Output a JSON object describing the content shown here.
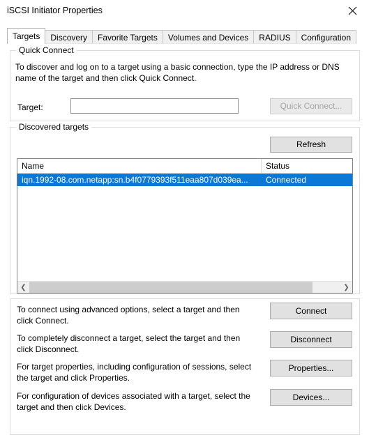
{
  "window": {
    "title": "iSCSI Initiator Properties",
    "close_icon": "close-icon"
  },
  "tabs": [
    {
      "label": "Targets",
      "selected": true
    },
    {
      "label": "Discovery",
      "selected": false
    },
    {
      "label": "Favorite Targets",
      "selected": false
    },
    {
      "label": "Volumes and Devices",
      "selected": false
    },
    {
      "label": "RADIUS",
      "selected": false
    },
    {
      "label": "Configuration",
      "selected": false
    }
  ],
  "quick_connect": {
    "group_title": "Quick Connect",
    "description": "To discover and log on to a target using a basic connection, type the IP address or DNS name of the target and then click Quick Connect.",
    "target_label": "Target:",
    "target_value": "",
    "target_placeholder": "",
    "button_label": "Quick Connect...",
    "button_disabled": true
  },
  "discovered_targets": {
    "group_title": "Discovered targets",
    "refresh_label": "Refresh",
    "columns": [
      "Name",
      "Status"
    ],
    "rows": [
      {
        "name": "iqn.1992-08.com.netapp:sn.b4f0779393f511eaa807d039ea...",
        "status": "Connected",
        "selected": true
      }
    ],
    "scrollbar": {
      "left_arrow": "chevron-left-icon",
      "right_arrow": "chevron-right-icon",
      "thumb_percent": 91
    }
  },
  "actions": [
    {
      "text": "To connect using advanced options, select a target and then click Connect.",
      "button": "Connect"
    },
    {
      "text": "To completely disconnect a target, select the target and then click Disconnect.",
      "button": "Disconnect"
    },
    {
      "text": "For target properties, including configuration of sessions, select the target and click Properties.",
      "button": "Properties..."
    },
    {
      "text": "For configuration of devices associated with a target, select the target and then click Devices.",
      "button": "Devices..."
    }
  ],
  "colors": {
    "selection_blue": "#0a78d7",
    "button_face": "#e1e1e1",
    "window_bg": "#ffffff"
  }
}
